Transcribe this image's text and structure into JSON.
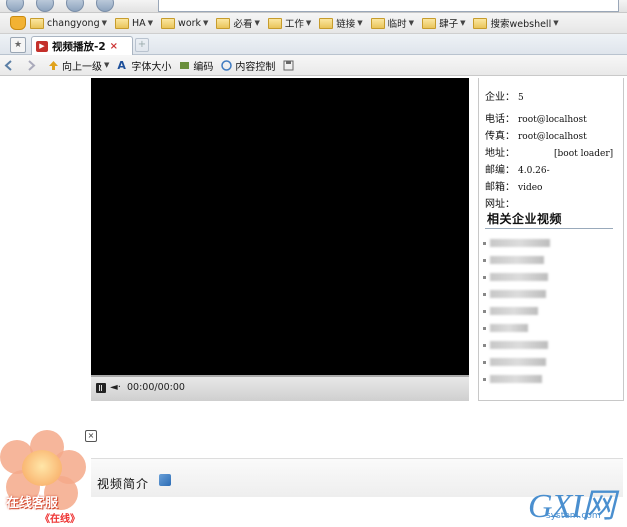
{
  "bookmarks": [
    "changyong",
    "HA",
    "work",
    "必看",
    "工作",
    "链接",
    "临时",
    "肆子",
    "搜索webshell"
  ],
  "tab": {
    "title": "视频播放-2"
  },
  "toolbar": {
    "up_label": "向上一级",
    "font_label": "字体大小",
    "encoding_label": "编码",
    "content_label": "内容控制"
  },
  "player": {
    "time": "00:00/00:00"
  },
  "info": {
    "rows": [
      {
        "key": "企业：",
        "value": "5"
      },
      {
        "key": "电话：",
        "value": "root@localhost"
      },
      {
        "key": "传真：",
        "value": "root@localhost"
      },
      {
        "key": "地址：",
        "value": "[boot loader]"
      },
      {
        "key": "邮编：",
        "value": "4.0.26-"
      },
      {
        "key": "邮箱：",
        "value": "video"
      },
      {
        "key": "网址：",
        "value": ""
      }
    ],
    "related_title": "相关企业视频"
  },
  "section": {
    "title": "视频简介"
  },
  "chat": {
    "label": "在线客服",
    "sub": "《在线》"
  },
  "watermark": {
    "main": "GXI网",
    "sub": "system.com"
  },
  "colors": {
    "tab_icon": "#c4302b",
    "watermark": "#4a8fcf",
    "player_bg": "#000000"
  }
}
